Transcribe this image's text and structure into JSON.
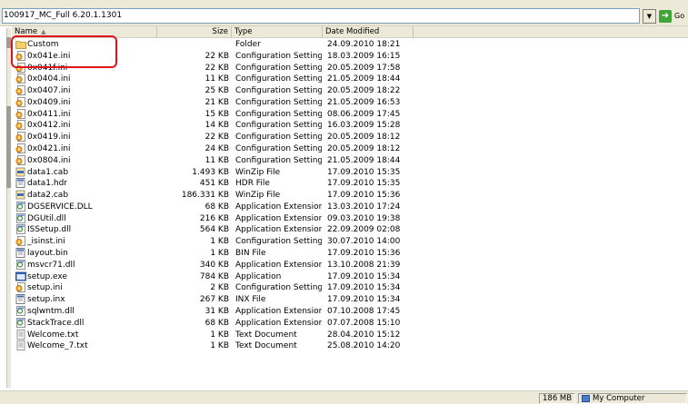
{
  "address": {
    "value": "100917_MC_Full 6.20.1.1301",
    "go_label": "Go"
  },
  "columns": {
    "name": "Name",
    "size": "Size",
    "type": "Type",
    "date": "Date Modified"
  },
  "colors": {
    "annotation": "#e0131b",
    "folder": "#f2cf6a",
    "ini": "#f5a623"
  },
  "files": [
    {
      "name": "Custom",
      "size": "",
      "type": "Folder",
      "date": "24.09.2010 18:21",
      "icon": "folder-icon"
    },
    {
      "name": "0x041e.ini",
      "size": "22 KB",
      "type": "Configuration Settings",
      "date": "18.03.2009 16:15",
      "icon": "ini-file-icon"
    },
    {
      "name": "0x041f.ini",
      "size": "22 KB",
      "type": "Configuration Settings",
      "date": "20.05.2009 17:58",
      "icon": "ini-file-icon"
    },
    {
      "name": "0x0404.ini",
      "size": "11 KB",
      "type": "Configuration Settings",
      "date": "21.05.2009 18:44",
      "icon": "ini-file-icon"
    },
    {
      "name": "0x0407.ini",
      "size": "25 KB",
      "type": "Configuration Settings",
      "date": "20.05.2009 18:22",
      "icon": "ini-file-icon"
    },
    {
      "name": "0x0409.ini",
      "size": "21 KB",
      "type": "Configuration Settings",
      "date": "21.05.2009 16:53",
      "icon": "ini-file-icon"
    },
    {
      "name": "0x0411.ini",
      "size": "15 KB",
      "type": "Configuration Settings",
      "date": "08.06.2009 17:45",
      "icon": "ini-file-icon"
    },
    {
      "name": "0x0412.ini",
      "size": "14 KB",
      "type": "Configuration Settings",
      "date": "16.03.2009 15:28",
      "icon": "ini-file-icon"
    },
    {
      "name": "0x0419.ini",
      "size": "22 KB",
      "type": "Configuration Settings",
      "date": "20.05.2009 18:12",
      "icon": "ini-file-icon"
    },
    {
      "name": "0x0421.ini",
      "size": "24 KB",
      "type": "Configuration Settings",
      "date": "20.05.2009 18:12",
      "icon": "ini-file-icon"
    },
    {
      "name": "0x0804.ini",
      "size": "11 KB",
      "type": "Configuration Settings",
      "date": "21.05.2009 18:44",
      "icon": "ini-file-icon"
    },
    {
      "name": "data1.cab",
      "size": "1.493 KB",
      "type": "WinZip File",
      "date": "17.09.2010 15:35",
      "icon": "cab-file-icon"
    },
    {
      "name": "data1.hdr",
      "size": "451 KB",
      "type": "HDR File",
      "date": "17.09.2010 15:35",
      "icon": "generic-file-icon"
    },
    {
      "name": "data2.cab",
      "size": "186.331 KB",
      "type": "WinZip File",
      "date": "17.09.2010 15:36",
      "icon": "cab-file-icon"
    },
    {
      "name": "DGSERVICE.DLL",
      "size": "68 KB",
      "type": "Application Extension",
      "date": "13.03.2010 17:24",
      "icon": "dll-file-icon"
    },
    {
      "name": "DGUtil.dll",
      "size": "216 KB",
      "type": "Application Extension",
      "date": "09.03.2010 19:38",
      "icon": "dll-file-icon"
    },
    {
      "name": "ISSetup.dll",
      "size": "564 KB",
      "type": "Application Extension",
      "date": "22.09.2009 02:08",
      "icon": "dll-file-icon"
    },
    {
      "name": "_isinst.ini",
      "size": "1 KB",
      "type": "Configuration Settings",
      "date": "30.07.2010 14:00",
      "icon": "ini-file-icon"
    },
    {
      "name": "layout.bin",
      "size": "1 KB",
      "type": "BIN File",
      "date": "17.09.2010 15:36",
      "icon": "generic-file-icon"
    },
    {
      "name": "msvcr71.dll",
      "size": "340 KB",
      "type": "Application Extension",
      "date": "13.10.2008 21:39",
      "icon": "dll-file-icon"
    },
    {
      "name": "setup.exe",
      "size": "784 KB",
      "type": "Application",
      "date": "17.09.2010 15:34",
      "icon": "exe-file-icon"
    },
    {
      "name": "setup.ini",
      "size": "2 KB",
      "type": "Configuration Settings",
      "date": "17.09.2010 15:34",
      "icon": "ini-file-icon"
    },
    {
      "name": "setup.inx",
      "size": "267 KB",
      "type": "INX File",
      "date": "17.09.2010 15:34",
      "icon": "generic-file-icon"
    },
    {
      "name": "sqlwntm.dll",
      "size": "31 KB",
      "type": "Application Extension",
      "date": "07.10.2008 17:45",
      "icon": "dll-file-icon"
    },
    {
      "name": "StackTrace.dll",
      "size": "68 KB",
      "type": "Application Extension",
      "date": "07.07.2008 15:10",
      "icon": "dll-file-icon"
    },
    {
      "name": "Welcome.txt",
      "size": "1 KB",
      "type": "Text Document",
      "date": "28.04.2010 15:12",
      "icon": "text-file-icon"
    },
    {
      "name": "Welcome_7.txt",
      "size": "1 KB",
      "type": "Text Document",
      "date": "25.08.2010 14:20",
      "icon": "text-file-icon"
    }
  ],
  "status": {
    "size": "186 MB",
    "location": "My Computer"
  }
}
